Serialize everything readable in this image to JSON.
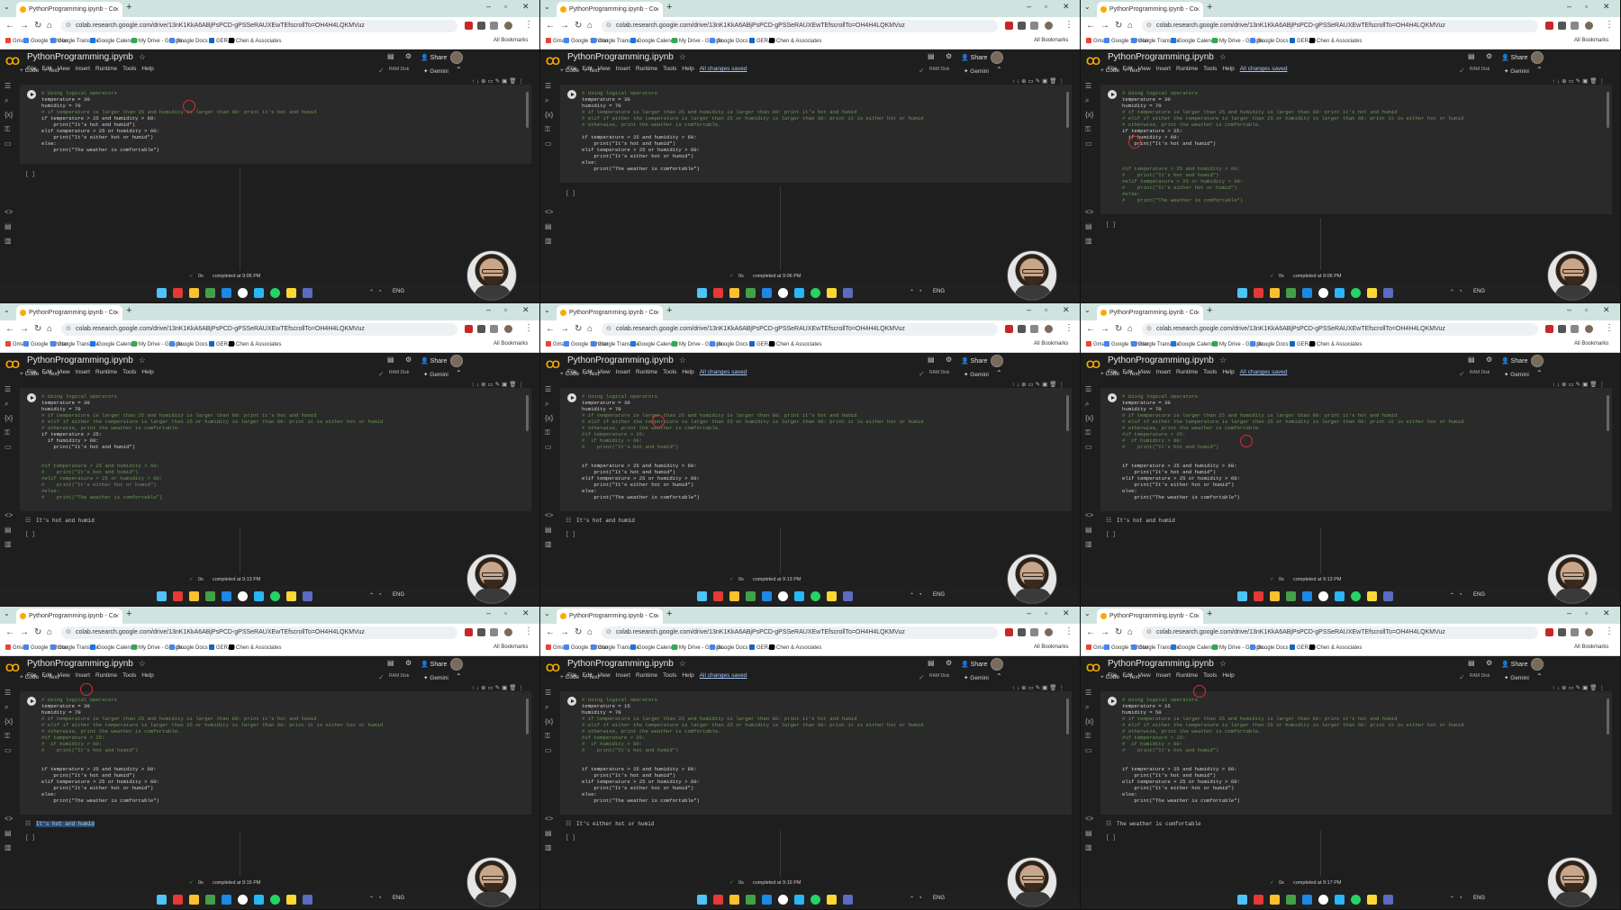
{
  "common": {
    "tab_title": "PythonProgramming.ipynb - Co",
    "url": "colab.research.google.com/drive/13nK1KkA6ABjPsPCD-gPSSeRAUXEwTEfscrollTo=OH4H4LQKMVuz",
    "bookmarks": [
      "Gmail",
      "Google Scholar",
      "Google Translate",
      "Google Calendar",
      "My Drive - Google...",
      "Google Docs",
      "GERAD",
      "Chen & Associates"
    ],
    "all_bookmarks": "All Bookmarks",
    "notebook_title": "PythonProgramming.ipynb",
    "menus": [
      "File",
      "Edit",
      "View",
      "Insert",
      "Runtime",
      "Tools",
      "Help"
    ],
    "saved_label": "All changes saved",
    "share_label": "Share",
    "add_code": "+ Code",
    "add_text": "+ Text",
    "gemini": "Gemini",
    "ram_disk": "RAM\nDisk",
    "status_ok": "✓",
    "duration": "0s",
    "lang": "ENG",
    "colors": {
      "accent": "#f9ab00",
      "comment": "#6a9955",
      "keyword": "#c586c0",
      "number": "#b5cea8",
      "string": "#ce9178",
      "selection": "#264f78"
    }
  },
  "panels": [
    {
      "saved": false,
      "code": [
        "# Using logical operators",
        "temperature = 30",
        "humidity = 70",
        "# if temperature is larger than 25 and humidity is larger than 60: print it's hot and humid",
        "if temperature > 25 and humidity > 60:",
        "    print(\"It's hot and humid\")",
        "elif temperature > 25 or humidity > 60:",
        "    print(\"It's either hot or humid\")",
        "else:",
        "    print(\"The weather is comfortable\")"
      ],
      "output": "",
      "completed": "completed at 9:06 PM"
    },
    {
      "saved": true,
      "code": [
        "# Using logical operators",
        "temperature = 30",
        "humidity = 70",
        "# if temperature is larger than 25 and humidity is larger than 60: print it's hot and humid",
        "# elif if either the temperature is larger than 25 or humidity is larger than 60: print it is either hot or humid",
        "# otherwise, print the weather is comfortable.",
        "",
        "if temperature > 25 and humidity > 60:",
        "    print(\"It's hot and humid\")",
        "elif temperature > 25 or humidity > 60:",
        "    print(\"It's either hot or humid\")",
        "else:",
        "    print(\"The weather is comfortable\")"
      ],
      "output": "",
      "completed": "completed at 9:06 PM"
    },
    {
      "saved": true,
      "code": [
        "# Using logical operators",
        "temperature = 30",
        "humidity = 70",
        "# if temperature is larger than 25 and humidity is larger than 60: print it's hot and humid",
        "# elif if either the temperature is larger than 25 or humidity is larger than 60: print it is either hot or humid",
        "# otherwise, print the weather is comfortable.",
        "if temperature > 25:",
        "  if humidity > 60:",
        "    print(\"It's hot and humid\")",
        "",
        "",
        "",
        "#if temperature > 25 and humidity > 60:",
        "#    print(\"It's hot and humid\")",
        "#elif temperature > 25 or humidity > 60:",
        "#    print(\"It's either hot or humid\")",
        "#else:",
        "#    print(\"The weather is comfortable\")"
      ],
      "output": "",
      "completed": "completed at 9:06 PM"
    },
    {
      "saved": false,
      "code": [
        "# Using logical operators",
        "temperature = 30",
        "humidity = 70",
        "# if temperature is larger than 25 and humidity is larger than 60: print it's hot and humid",
        "# elif if either the temperature is larger than 25 or humidity is larger than 60: print it is either hot or humid",
        "# otherwise, print the weather is comfortable.",
        "if temperature > 25:",
        "  if humidity > 60:",
        "    print(\"It's hot and humid\")",
        "",
        "",
        "#if temperature > 25 and humidity > 60:",
        "#    print(\"It's hot and humid\")",
        "#elif temperature > 25 or humidity > 60:",
        "#    print(\"It's either hot or humid\")",
        "#else:",
        "#    print(\"The weather is comfortable\")"
      ],
      "output": "It's hot and humid",
      "completed": "completed at 9:13 PM"
    },
    {
      "saved": true,
      "code": [
        "# Using logical operators",
        "temperature = 30",
        "humidity = 70",
        "# if temperature is larger than 25 and humidity is larger than 60: print it's hot and humid",
        "# elif if either the temperature is larger than 25 or humidity is larger than 60: print it is either hot or humid",
        "# otherwise, print the weather is comfortable.",
        "#if temperature > 25:",
        "#  if humidity > 60:",
        "#    print(\"It's hot and humid\")",
        "",
        "",
        "if temperature > 25 and humidity > 60:",
        "    print(\"It's hot and humid\")",
        "elif temperature > 25 or humidity > 60:",
        "    print(\"It's either hot or humid\")",
        "else:",
        "    print(\"The weather is comfortable\")"
      ],
      "output": "It's hot and humid",
      "completed": "completed at 9:13 PM"
    },
    {
      "saved": true,
      "code": [
        "# Using logical operators",
        "temperature = 30",
        "humidity = 70",
        "# if temperature is larger than 25 and humidity is larger than 60: print it's hot and humid",
        "# elif if either the temperature is larger than 25 or humidity is larger than 60: print it is either hot or humid",
        "# otherwise, print the weather is comfortable.",
        "#if temperature > 25:",
        "#  if humidity > 60:",
        "#    print(\"It's hot and humid\")",
        "",
        "",
        "if temperature > 25 and humidity > 60:",
        "    print(\"It's hot and humid\")",
        "elif temperature > 25 or humidity > 60:",
        "    print(\"It's either hot or humid\")",
        "else:",
        "    print(\"The weather is comfortable\")"
      ],
      "output": "It's hot and humid",
      "completed": "completed at 9:13 PM"
    },
    {
      "saved": false,
      "code": [
        "# Using logical operators",
        "temperature = 30",
        "humidity = 70",
        "# if temperature is larger than 25 and humidity is larger than 60: print it's hot and humid",
        "# elif if either the temperature is larger than 25 or humidity is larger than 60: print it is either hot or humid",
        "# otherwise, print the weather is comfortable.",
        "#if temperature > 25:",
        "#  if humidity > 60:",
        "#    print(\"It's hot and humid\")",
        "",
        "",
        "if temperature > 25 and humidity > 60:",
        "    print(\"It's hot and humid\")",
        "elif temperature > 25 or humidity > 60:",
        "    print(\"It's either hot or humid\")",
        "else:",
        "    print(\"The weather is comfortable\")"
      ],
      "output": "It's hot and humid",
      "completed": "completed at 9:16 PM"
    },
    {
      "saved": true,
      "code": [
        "# Using logical operators",
        "temperature = 15",
        "humidity = 70",
        "# if temperature is larger than 25 and humidity is larger than 60: print it's hot and humid",
        "# elif if either the temperature is larger than 25 or humidity is larger than 60: print it is either hot or humid",
        "# otherwise, print the weather is comfortable.",
        "#if temperature > 25:",
        "#  if humidity > 60:",
        "#    print(\"It's hot and humid\")",
        "",
        "",
        "if temperature > 25 and humidity > 60:",
        "    print(\"It's hot and humid\")",
        "elif temperature > 25 or humidity > 60:",
        "    print(\"It's either hot or humid\")",
        "else:",
        "    print(\"The weather is comfortable\")"
      ],
      "output": "It's either hot or humid",
      "completed": "completed at 9:16 PM"
    },
    {
      "saved": false,
      "code": [
        "# Using logical operators",
        "temperature = 15",
        "humidity = 50",
        "# if temperature is larger than 25 and humidity is larger than 60: print it's hot and humid",
        "# elif if either the temperature is larger than 25 or humidity is larger than 60: print it is either hot or humid",
        "# otherwise, print the weather is comfortable.",
        "#if temperature > 25:",
        "#  if humidity > 60:",
        "#    print(\"It's hot and humid\")",
        "",
        "",
        "if temperature > 25 and humidity > 60:",
        "    print(\"It's hot and humid\")",
        "elif temperature > 25 or humidity > 60:",
        "    print(\"It's either hot or humid\")",
        "else:",
        "    print(\"The weather is comfortable\")"
      ],
      "output": "The weather is comfortable",
      "completed": "completed at 9:17 PM"
    }
  ]
}
